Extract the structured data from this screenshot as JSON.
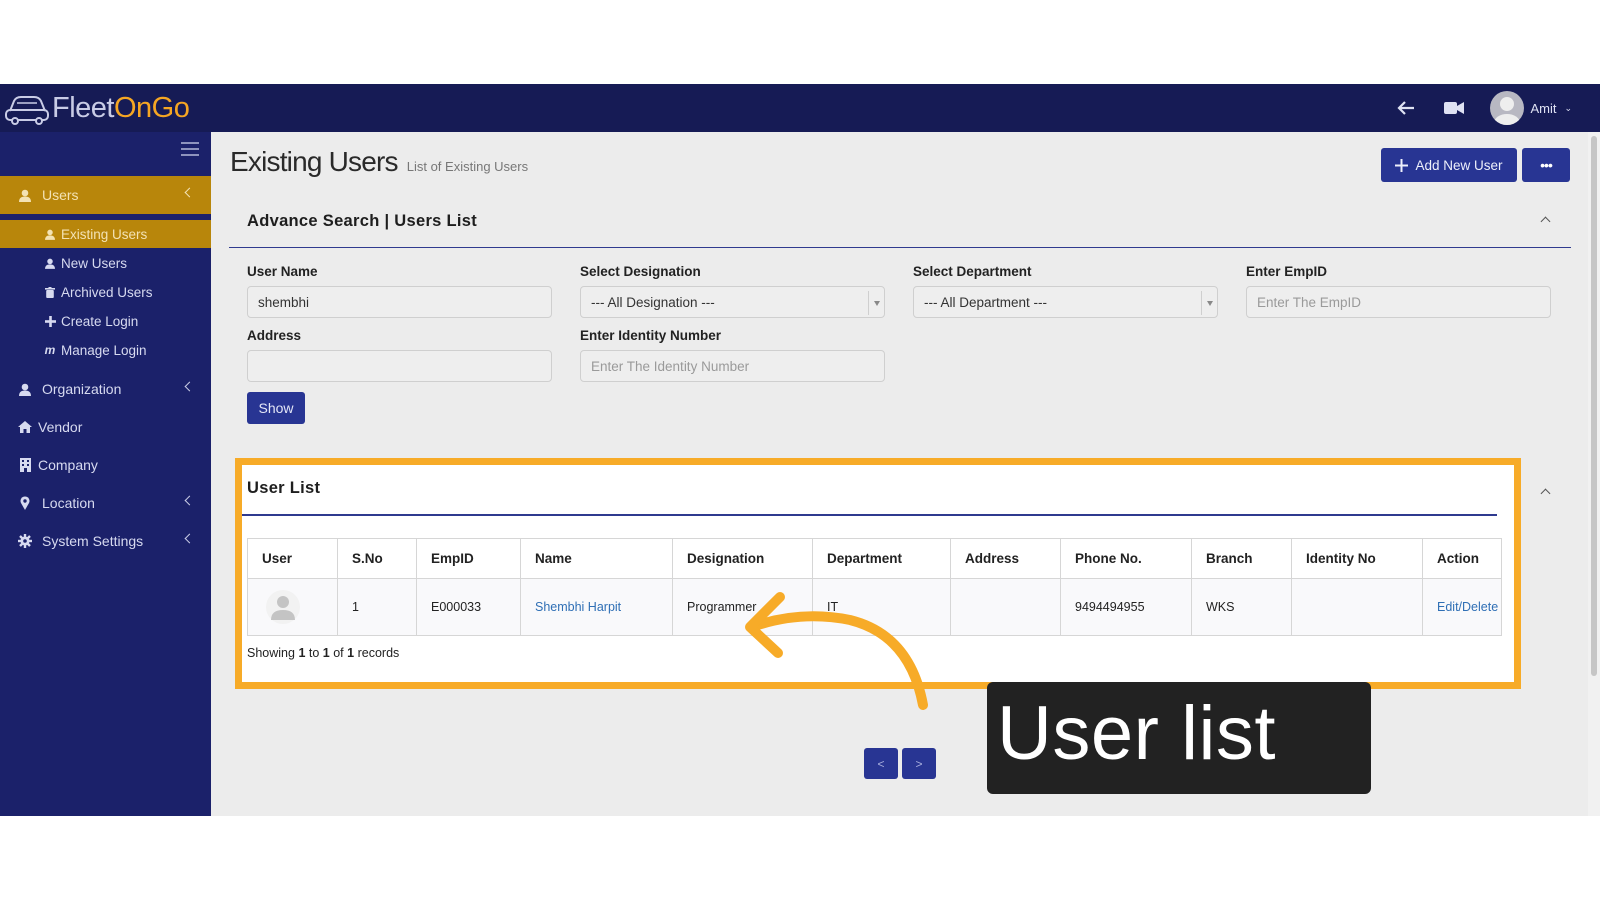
{
  "app": {
    "logo_text_primary": "Fleet",
    "logo_text_accent": "OnGo",
    "user_name": "Amit"
  },
  "sidebar": {
    "items": [
      {
        "label": "Users",
        "icon": "user-icon"
      },
      {
        "label": "Organization",
        "icon": "user-icon"
      },
      {
        "label": "Vendor",
        "icon": "home-icon"
      },
      {
        "label": "Company",
        "icon": "building-icon"
      },
      {
        "label": "Location",
        "icon": "map-pin-icon"
      },
      {
        "label": "System Settings",
        "icon": "gear-icon"
      }
    ],
    "users_submenu": [
      {
        "label": "Existing Users",
        "icon": "user-icon"
      },
      {
        "label": "New Users",
        "icon": "user-icon"
      },
      {
        "label": "Archived Users",
        "icon": "trash-icon"
      },
      {
        "label": "Create Login",
        "icon": "plus-icon"
      },
      {
        "label": "Manage Login",
        "icon": "m-icon"
      }
    ]
  },
  "header": {
    "title": "Existing Users",
    "subtitle": "List of Existing Users",
    "add_button": "Add New User",
    "more_button": "•••"
  },
  "search": {
    "panel_title": "Advance Search | Users List",
    "fields": {
      "user_name": {
        "label": "User Name",
        "value": "shembhi"
      },
      "designation": {
        "label": "Select Designation",
        "value": "--- All Designation ---"
      },
      "department": {
        "label": "Select Department",
        "value": "--- All Department ---"
      },
      "empid": {
        "label": "Enter EmpID",
        "placeholder": "Enter The EmpID"
      },
      "address": {
        "label": "Address",
        "value": ""
      },
      "identity": {
        "label": "Enter Identity Number",
        "placeholder": "Enter The Identity Number"
      }
    },
    "show_button": "Show"
  },
  "user_list": {
    "title": "User List",
    "columns": [
      "User",
      "S.No",
      "EmpID",
      "Name",
      "Designation",
      "Department",
      "Address",
      "Phone No.",
      "Branch",
      "Identity No",
      "Action"
    ],
    "rows": [
      {
        "sno": "1",
        "empid": "E000033",
        "name": "Shembhi Harpit",
        "designation": "Programmer",
        "department": "IT",
        "address": "",
        "phone": "9494494955",
        "branch": "WKS",
        "identity": "",
        "action": "Edit/Delete"
      }
    ],
    "records_prefix": "Showing",
    "records_from": "1",
    "records_to_word": "to",
    "records_to": "1",
    "records_of_word": "of",
    "records_total": "1",
    "records_suffix": "records"
  },
  "pagination": {
    "prev": "<",
    "next": ">"
  },
  "annotation": {
    "callout": "User list"
  },
  "colors": {
    "brand_navy": "#161b55",
    "sidebar": "#1b216a",
    "accent_gold": "#b8860b",
    "highlight": "#f7ab28",
    "button": "#283593"
  }
}
